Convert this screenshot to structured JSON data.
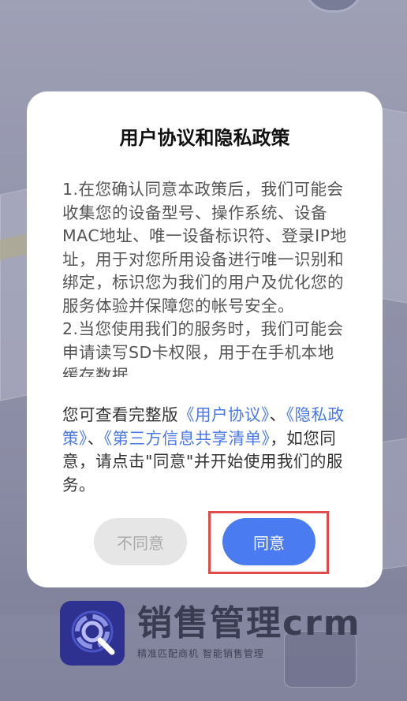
{
  "dialog": {
    "title": "用户协议和隐私政策",
    "body_paragraphs": [
      "1.在您确认同意本政策后，我们可能会收集您的设备型号、操作系统、设备MAC地址、唯一设备标识符、登录IP地址，用于对您所用设备进行唯一识别和绑定，标识您为我们的用户及优化您的服务体验并保障您的帐号安全。",
      "2.当您使用我们的服务时，我们可能会申请读写SD卡权限，用于在手机本地缓存数据"
    ],
    "footer": {
      "prefix": "您可查看完整版",
      "link_user_agreement": "《用户协议》",
      "sep1": "、",
      "link_privacy_policy": "《隐私政策》",
      "sep2": "、",
      "link_third_party": "《第三方信息共享清单》",
      "suffix": "，如您同意，请点击\"同意\"并开始使用我们的服务。"
    },
    "disagree_label": "不同意",
    "agree_label": "同意"
  },
  "brand": {
    "name": "销售管理crm",
    "slogan": "精准匹配商机  智能销售管理",
    "logo_icon": "search-magnifier-logo-icon"
  },
  "colors": {
    "link": "#4a78e8",
    "agree_button": "#4a7bf0",
    "highlight": "#e14b4b"
  }
}
